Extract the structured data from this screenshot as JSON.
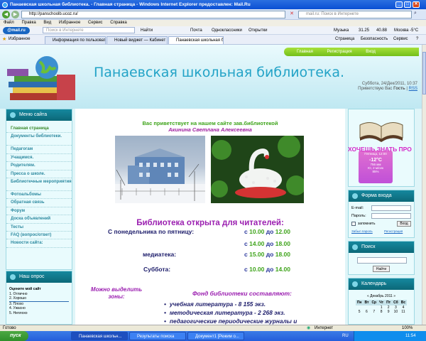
{
  "window": {
    "title": "Панаевская школьная библиотека. - Главная страница - Windows Internet Explorer предоставлен: Mail.Ru",
    "url": "http://panschoolb.ucoz.ru/",
    "search_placeholder": "mail.ru: Поиск в Интернете",
    "min": "_",
    "max": "□",
    "close": "✕"
  },
  "menubar": [
    "Файл",
    "Правка",
    "Вид",
    "Избранное",
    "Сервис",
    "Справка"
  ],
  "mailbar": {
    "logo": "@mail.ru",
    "search_placeholder": "Поиск в Интернете",
    "find": "Найти",
    "mail": "Почта",
    "ok": "Одноклассники",
    "cards": "Открытки",
    "music": "Музыка",
    "weather": "31.25",
    "rate": "40.88",
    "city": "Москва -5°C"
  },
  "tabs": {
    "favorites": "Избранное",
    "items": [
      "Информация по пользовате...",
      "Новый виджет — Кабинет ...",
      "Панаевская школьная б..."
    ],
    "page": "Страница",
    "safety": "Безопасность",
    "service": "Сервис",
    "help": "?"
  },
  "site": {
    "toplinks": [
      "Главная",
      "Регистрация",
      "Вход"
    ],
    "title": "Панаевская школьная библиотека.",
    "date": "Суббота, 24/Дек/2011, 10:37",
    "greeting": "Приветствую Вас",
    "guest": "Гость",
    "rss": "RSS",
    "marquee": "ХОЧЕШЬ ЗНАТЬ ПРО",
    "menu_head": "Меню сайта",
    "menu": [
      "Главная страница",
      "Документы библиотеки.",
      "Педагогам",
      "Учащимся.",
      "Родителям.",
      "Пресса о школе.",
      "Библиотечные мероприятия",
      "Фотоальбомы",
      "Обратная связь",
      "Форум",
      "Доска объявлений",
      "Тесты",
      "FAQ (вопрос/ответ)",
      "Новости сайта:"
    ],
    "poll_head": "Наш опрос",
    "poll_title": "Оцените мой сайт",
    "poll_options": [
      "1. Отлично",
      "2. Хорошо",
      "3. Плохо",
      "4. Ужасно",
      "5. Неплохо"
    ],
    "welcome": "Вас приветствует на нашем сайте зав.библиотекой",
    "librarian": "Акинина Светлана Алексеевна",
    "open_head": "Библиотека открыта для читателей:",
    "schedule": [
      {
        "label": "С понедельника по пятницу:",
        "from": "10.00",
        "to": "12.00"
      },
      {
        "label": "",
        "from": "14.00",
        "to": "18.00"
      },
      {
        "label": "медиатека:",
        "from": "15.00",
        "to": "18.00"
      },
      {
        "label": "Суббота:",
        "from": "10.00",
        "to": "14.00"
      }
    ],
    "word_from": "с",
    "word_to": "до",
    "zones": "Можно выделить зоны:",
    "fund_head": "Фонд библиотеки составляют:",
    "fund": [
      "учебная литература - 8 155 экз.",
      "методическая литература - 2 268 экз.",
      "педагогические периодические журналы и"
    ],
    "weather_widget": {
      "date": "Пятница, 12:00",
      "temp": "-12°C",
      "line1": "756 мм",
      "line2": "Ю, 2 м/сек",
      "line3": "85%"
    },
    "login_head": "Форма входа",
    "login_email": "E-mail:",
    "login_pass": "Пароль:",
    "remember": "запомнить",
    "login_btn": "Вход",
    "forgot": "Забыл пароль",
    "register": "Регистрация",
    "search_head": "Поиск",
    "search_btn": "Найти",
    "cal_head": "Календарь",
    "cal_month": "« Декабрь 2011 »",
    "cal_days": [
      "Пн",
      "Вт",
      "Ср",
      "Чт",
      "Пт",
      "Сб",
      "Вс"
    ],
    "cal_rows": [
      [
        "",
        "",
        "",
        "1",
        "2",
        "3",
        "4"
      ],
      [
        "5",
        "6",
        "7",
        "8",
        "9",
        "10",
        "11"
      ]
    ]
  },
  "status": {
    "left": "Готово",
    "zone": "Интернет",
    "zoom": "100%"
  },
  "taskbar": {
    "start": "пуск",
    "tasks": [
      "Панаевская школьн...",
      "Результаты поиска",
      "Документ1 [Режим о..."
    ],
    "lang": "RU",
    "clock": "11:54"
  }
}
